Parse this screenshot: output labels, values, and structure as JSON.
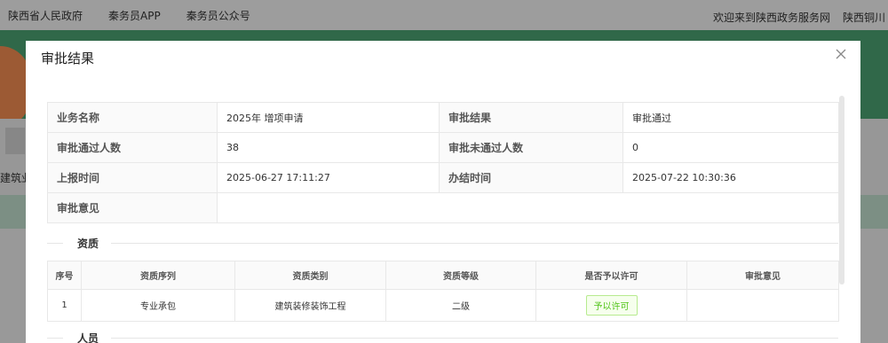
{
  "background": {
    "top_nav_left": [
      "陕西省人民政府",
      "秦务员APP",
      "秦务员公众号"
    ],
    "welcome_text": "欢迎来到陕西政务服务网",
    "region_text": "陕西铜川",
    "side_label": "建筑业"
  },
  "modal": {
    "title": "审批结果",
    "close_icon": "close-icon",
    "info": {
      "business_name_label": "业务名称",
      "business_name_value": "2025年 增项申请",
      "result_label": "审批结果",
      "result_value": "审批通过",
      "approved_count_label": "审批通过人数",
      "approved_count_value": "38",
      "rejected_count_label": "审批未通过人数",
      "rejected_count_value": "0",
      "report_time_label": "上报时间",
      "report_time_value": "2025-06-27 17:11:27",
      "finish_time_label": "办结时间",
      "finish_time_value": "2025-07-22 10:30:36",
      "opinion_label": "审批意见",
      "opinion_value": ""
    },
    "qualification_section_title": "资质",
    "qualification_table": {
      "headers": [
        "序号",
        "资质序列",
        "资质类别",
        "资质等级",
        "是否予以许可",
        "审批意见"
      ],
      "rows": [
        {
          "no": "1",
          "series": "专业承包",
          "category": "建筑装修装饰工程",
          "level": "二级",
          "permitted": "予以许可",
          "opinion": ""
        }
      ]
    },
    "personnel_section_title": "人员"
  },
  "colors": {
    "overlay": "rgba(0,0,0,0.35)",
    "tag_green": "#52c41a",
    "tag_bg": "#f6ffed",
    "tag_border": "#b7eb8f"
  }
}
